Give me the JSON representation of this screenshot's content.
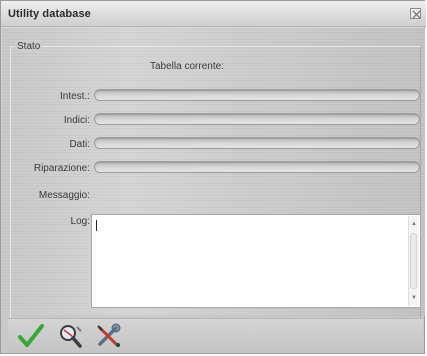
{
  "window": {
    "title": "Utility database"
  },
  "stato_group": {
    "legend": "Stato",
    "current_table_label": "Tabella corrente:"
  },
  "progress_rows": [
    {
      "label": "Intest.:",
      "value": 0
    },
    {
      "label": "Indici:",
      "value": 0
    },
    {
      "label": "Dati:",
      "value": 0
    },
    {
      "label": "Riparazione:",
      "value": 0
    }
  ],
  "message": {
    "label": "Messaggio:"
  },
  "log": {
    "label": "Log:",
    "value": ""
  },
  "toolbar": {
    "buttons": [
      {
        "name": "confirm",
        "icon": "checkmark-icon",
        "color": "#3aa63a"
      },
      {
        "name": "check-database",
        "icon": "magnifier-tool-icon"
      },
      {
        "name": "repair-database",
        "icon": "wrench-screwdriver-icon"
      }
    ]
  }
}
